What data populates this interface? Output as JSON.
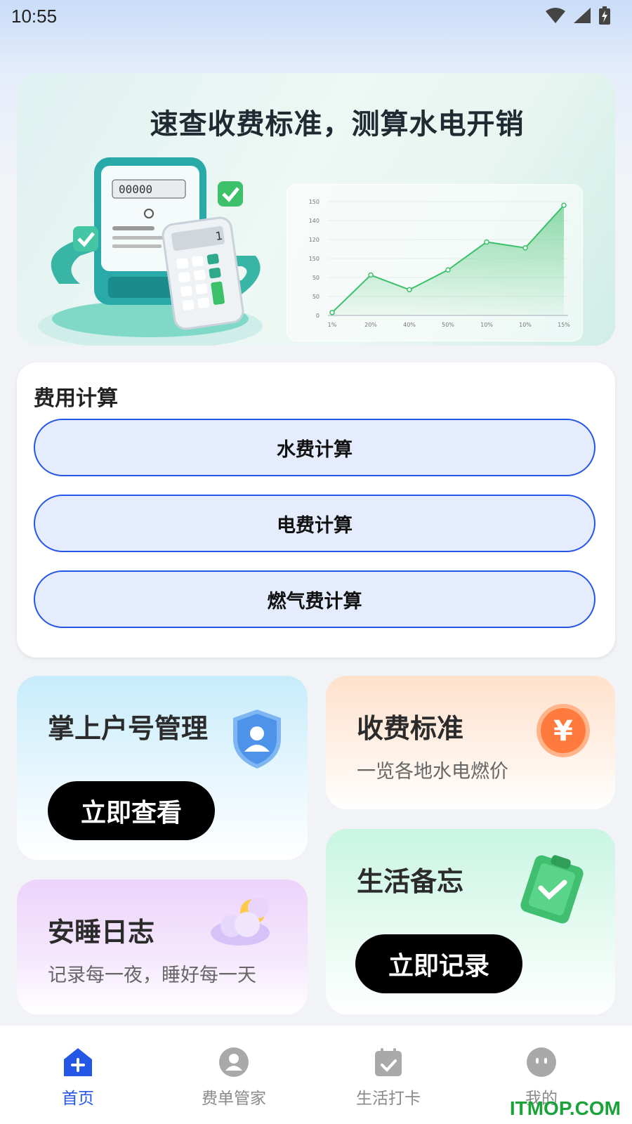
{
  "status_bar": {
    "time": "10:55"
  },
  "banner": {
    "title": "速查收费标准，测算水电开销",
    "chart_data": {
      "type": "area",
      "categories": [
        "1%",
        "20%",
        "40%",
        "50%",
        "10%",
        "10%",
        "15%"
      ],
      "values": [
        4,
        55,
        35,
        62,
        100,
        92,
        150
      ],
      "yticks": [
        "0",
        "50",
        "50",
        "150",
        "120",
        "140",
        "150"
      ],
      "title": "",
      "xlabel": "",
      "ylabel": "",
      "color": "#3cc06a"
    },
    "calculator_display": "1"
  },
  "calc_section": {
    "title": "费用计算",
    "buttons": [
      {
        "label": "水费计算"
      },
      {
        "label": "电费计算"
      },
      {
        "label": "燃气费计算"
      }
    ]
  },
  "tiles": {
    "account": {
      "title": "掌上户号管理",
      "button": "立即查看"
    },
    "fees": {
      "title": "收费标准",
      "subtitle": "一览各地水电燃价",
      "icon_glyph": "¥"
    },
    "sleep": {
      "title": "安睡日志",
      "subtitle": "记录每一夜，睡好每一天"
    },
    "memo": {
      "title": "生活备忘",
      "button": "立即记录"
    }
  },
  "tabbar": {
    "items": [
      {
        "label": "首页",
        "icon": "home-plus-icon",
        "active": true
      },
      {
        "label": "费单管家",
        "icon": "person-icon",
        "active": false
      },
      {
        "label": "生活打卡",
        "icon": "calendar-check-icon",
        "active": false
      },
      {
        "label": "我的",
        "icon": "face-icon",
        "active": false
      }
    ]
  },
  "watermark": "ITMOP.COM",
  "colors": {
    "accent": "#2457e6",
    "button_fill": "#e5ecfd",
    "chart_green": "#3cc06a"
  }
}
